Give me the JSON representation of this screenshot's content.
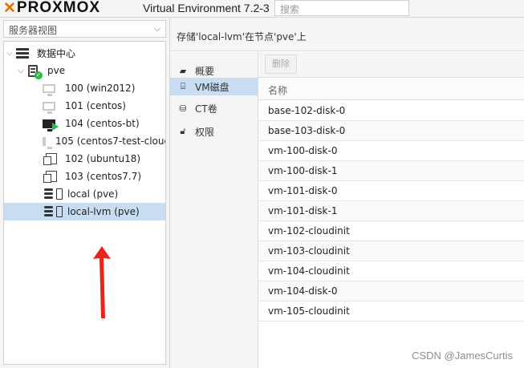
{
  "app": {
    "logo_text": "PROXMOX",
    "version": "Virtual Environment 7.2-3",
    "search_placeholder": "搜索",
    "brand_color": "#e57000"
  },
  "left": {
    "view_select": "服务器视图",
    "tree": [
      {
        "label": "数据中心",
        "icon": "datacenter-icon"
      },
      {
        "label": "pve",
        "icon": "node-icon"
      },
      {
        "label": "100 (win2012)",
        "icon": "vm-icon"
      },
      {
        "label": "101 (centos)",
        "icon": "vm-icon"
      },
      {
        "label": "104 (centos-bt)",
        "icon": "vm-running-icon"
      },
      {
        "label": "105 (centos7-test-cloud",
        "icon": "vm-icon"
      },
      {
        "label": "102 (ubuntu18)",
        "icon": "template-icon"
      },
      {
        "label": "103 (centos7.7)",
        "icon": "template-icon"
      },
      {
        "label": "local (pve)",
        "icon": "storage-icon"
      },
      {
        "label": "local-lvm (pve)",
        "icon": "storage-icon",
        "selected": true
      }
    ]
  },
  "right": {
    "header": "存储'local-lvm'在节点'pve'上",
    "nav": [
      {
        "label": "概要",
        "icon": "book-icon"
      },
      {
        "label": "VM磁盘",
        "icon": "hdd-icon",
        "active": true
      },
      {
        "label": "CT卷",
        "icon": "ct-icon"
      },
      {
        "label": "权限",
        "icon": "unlock-icon"
      }
    ],
    "toolbar": {
      "delete_label": "删除"
    },
    "table": {
      "column": "名称",
      "rows": [
        "base-102-disk-0",
        "base-103-disk-0",
        "vm-100-disk-0",
        "vm-100-disk-1",
        "vm-101-disk-0",
        "vm-101-disk-1",
        "vm-102-cloudinit",
        "vm-103-cloudinit",
        "vm-104-cloudinit",
        "vm-104-disk-0",
        "vm-105-cloudinit"
      ]
    }
  },
  "watermark": "CSDN @JamesCurtis"
}
